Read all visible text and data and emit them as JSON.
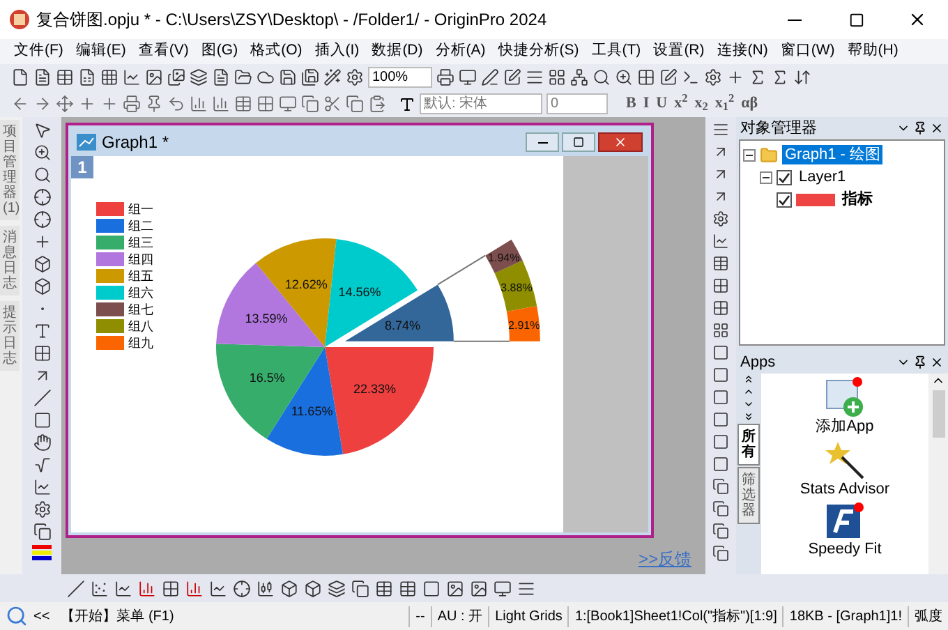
{
  "window": {
    "title": "复合饼图.opju * - C:\\Users\\ZSY\\Desktop\\ - /Folder1/ - OriginPro 2024"
  },
  "menu": [
    "文件(F)",
    "编辑(E)",
    "查看(V)",
    "图(G)",
    "格式(O)",
    "插入(I)",
    "数据(D)",
    "分析(A)",
    "快捷分析(S)",
    "工具(T)",
    "设置(R)",
    "连接(N)",
    "窗口(W)",
    "帮助(H)"
  ],
  "toolbar": {
    "zoom": "100%",
    "font": "默认: 宋体",
    "font_size": "0",
    "format_buttons": [
      "B",
      "I",
      "U",
      "x$^{2}$",
      "x$_{2}$",
      "x$_{1}$$^{2}$",
      "αβ"
    ]
  },
  "side_tabs": [
    {
      "label": "项目管理器 (1)"
    },
    {
      "label": "消息日志"
    },
    {
      "label": "提示日志"
    }
  ],
  "graph_window": {
    "title": "Graph1 *",
    "layer": "1",
    "legend": [
      {
        "label": "组一",
        "color": "#ef4040"
      },
      {
        "label": "组二",
        "color": "#1a6fdf"
      },
      {
        "label": "组三",
        "color": "#37ad6b"
      },
      {
        "label": "组四",
        "color": "#b177de"
      },
      {
        "label": "组五",
        "color": "#cc9900"
      },
      {
        "label": "组六",
        "color": "#00cbcc"
      },
      {
        "label": "组七",
        "color": "#7d4e4e"
      },
      {
        "label": "组八",
        "color": "#8e8e00"
      },
      {
        "label": "组九",
        "color": "#fb6501"
      }
    ],
    "pie": {
      "slices": [
        {
          "color": "#ef4040"
        },
        {
          "color": "#1a6fdf"
        },
        {
          "color": "#37ad6b"
        },
        {
          "color": "#b177de"
        },
        {
          "color": "#cc9900"
        },
        {
          "color": "#00cbcc"
        },
        {
          "color": "#336699"
        }
      ],
      "chart_data": {
        "type": "pie",
        "values": [
          22.33,
          11.65,
          16.5,
          13.59,
          12.62,
          14.56,
          8.74
        ],
        "value_labels": [
          "22.33%",
          "11.65%",
          "16.5%",
          "13.59%",
          "12.62%",
          "14.56%",
          "8.74%"
        ]
      }
    },
    "detail": {
      "segments": [
        {
          "label": "2.91%",
          "color": "#fb6501"
        },
        {
          "label": "3.88%",
          "color": "#8e8e00"
        },
        {
          "label": "1.94%",
          "color": "#7d4e4e"
        }
      ]
    }
  },
  "feedback_link": ">>反馈",
  "object_manager": {
    "title": "对象管理器",
    "tree": [
      {
        "label": "Graph1 - 绘图",
        "selected": true,
        "expanded": true,
        "children": [
          {
            "label": "Layer1",
            "checked": true,
            "expanded": true,
            "children": [
              {
                "label": "指标",
                "checked": true,
                "color": "#ef4444"
              }
            ]
          }
        ]
      }
    ]
  },
  "apps": {
    "title": "Apps",
    "tabs": [
      {
        "label": "所有",
        "selected": true
      },
      {
        "label": "筛选器",
        "selected": false
      }
    ],
    "items": [
      {
        "label": "添加App",
        "kind": "add"
      },
      {
        "label": "Stats Advisor",
        "kind": "wand"
      },
      {
        "label": "Speedy Fit",
        "kind": "fit"
      }
    ]
  },
  "status_bar": [
    "<<",
    "【开始】菜单 (F1)",
    "--",
    "AU : 开",
    "Light Grids",
    "1:[Book1]Sheet1!Col(\"指标\")[1:9]",
    "18KB - [Graph1]1!",
    "弧度"
  ]
}
